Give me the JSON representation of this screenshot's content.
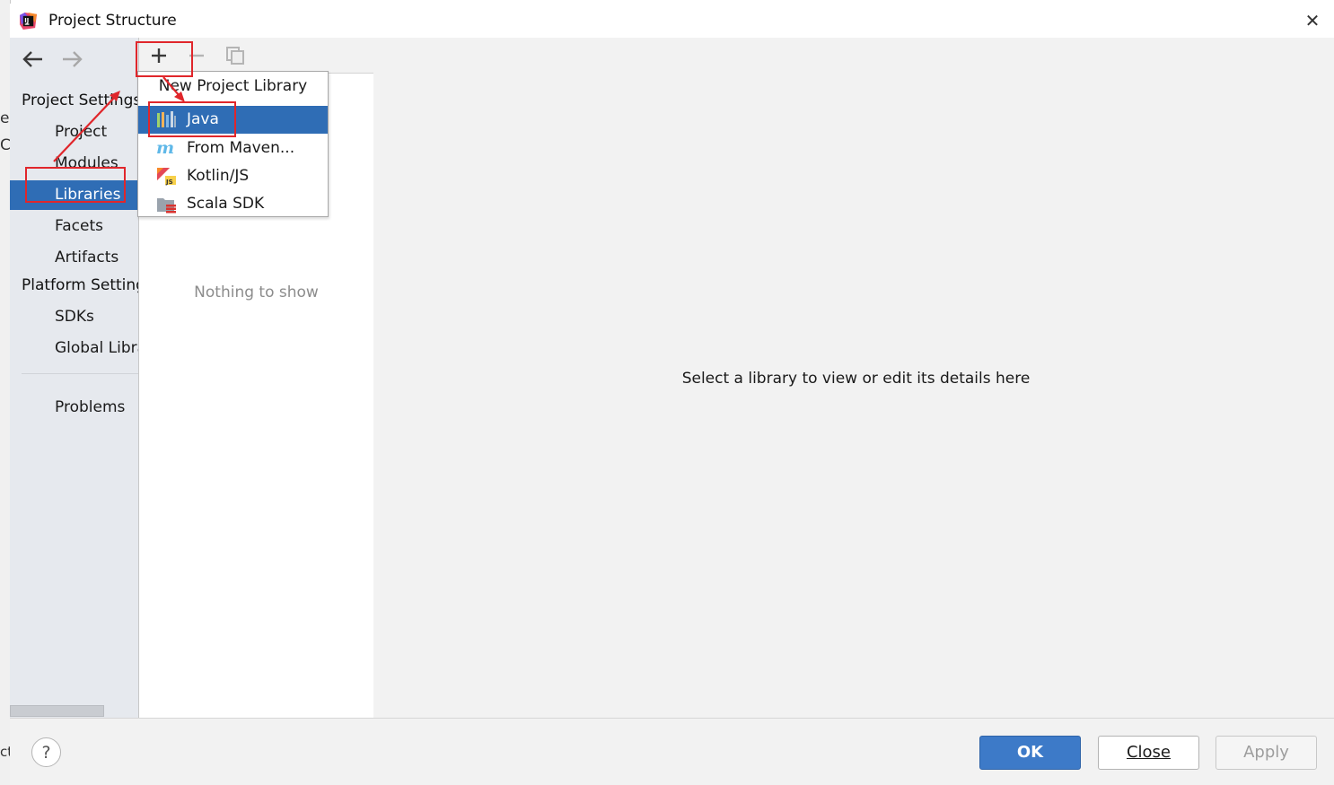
{
  "background": {
    "fragments": [
      "e",
      "C",
      "ct"
    ]
  },
  "window": {
    "title": "Project Structure",
    "close_icon": "close-icon",
    "app_icon": "intellij-idea-icon"
  },
  "sidebar": {
    "sections": [
      {
        "title": "Project Settings",
        "items": [
          "Project",
          "Modules",
          "Libraries",
          "Facets",
          "Artifacts"
        ]
      },
      {
        "title": "Platform Settings",
        "items": [
          "SDKs",
          "Global Libraries"
        ]
      }
    ],
    "problems": "Problems",
    "selected": "Libraries"
  },
  "toolbar": {
    "add_icon": "plus-icon",
    "remove_icon": "minus-icon",
    "copy_icon": "copy-icon"
  },
  "list_panel": {
    "empty_text": "Nothing to show"
  },
  "popup": {
    "title": "New Project Library",
    "items": [
      {
        "label": "Java",
        "icon": "java-library-icon",
        "selected": true
      },
      {
        "label": "From Maven...",
        "icon": "maven-icon",
        "selected": false
      },
      {
        "label": "Kotlin/JS",
        "icon": "kotlin-js-icon",
        "selected": false
      },
      {
        "label": "Scala SDK",
        "icon": "scala-sdk-icon",
        "selected": false
      }
    ]
  },
  "detail": {
    "text": "Select a library to view or edit its details here"
  },
  "footer": {
    "help": "?",
    "ok": "OK",
    "close": "Close",
    "apply": "Apply"
  },
  "colors": {
    "selection": "#2f6db5",
    "annotation": "#e0262b",
    "ok_button": "#3d7ac8"
  }
}
